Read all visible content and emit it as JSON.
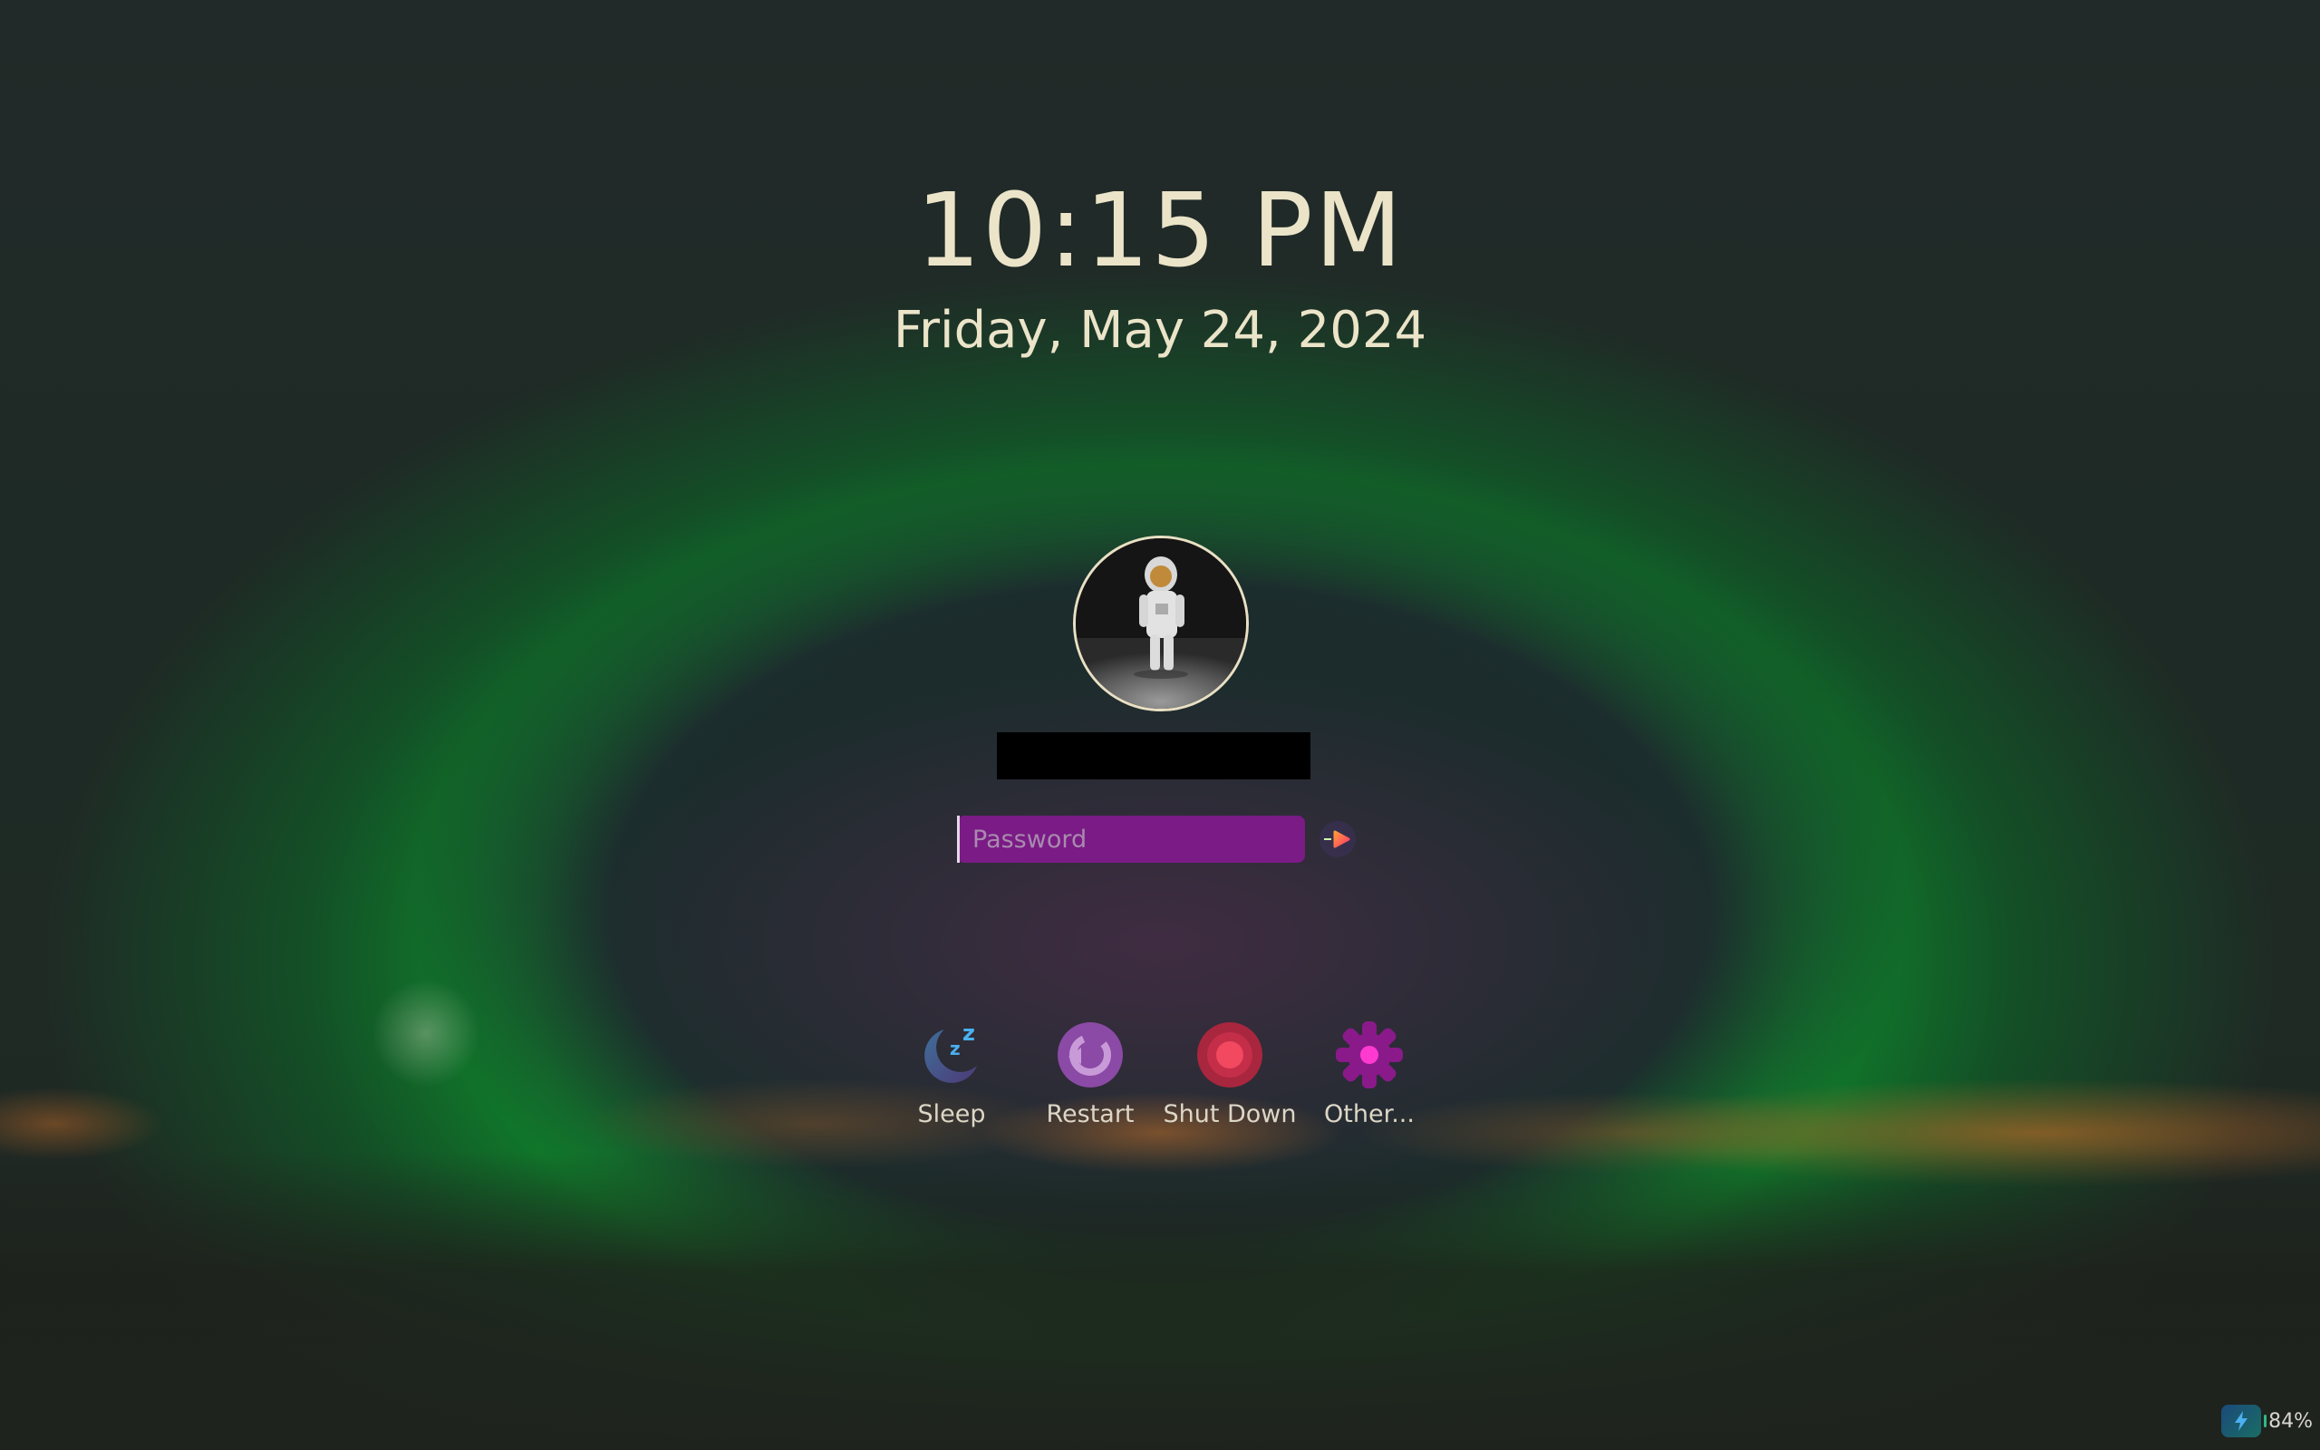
{
  "clock": {
    "time": "10:15 PM",
    "date": "Friday, May 24, 2024"
  },
  "user": {
    "avatar": "astronaut-photo",
    "name": ""
  },
  "password": {
    "placeholder": "Password",
    "value": "",
    "field_color": "#7a1b86"
  },
  "submit": {
    "icon": "arrow-right-icon"
  },
  "actions": [
    {
      "label": "Sleep",
      "icon": "sleep-icon"
    },
    {
      "label": "Restart",
      "icon": "restart-icon"
    },
    {
      "label": "Shut Down",
      "icon": "shut-down-icon"
    },
    {
      "label": "Other...",
      "icon": "gear-icon"
    }
  ],
  "status": {
    "battery_percent": "84%",
    "charging": true
  }
}
